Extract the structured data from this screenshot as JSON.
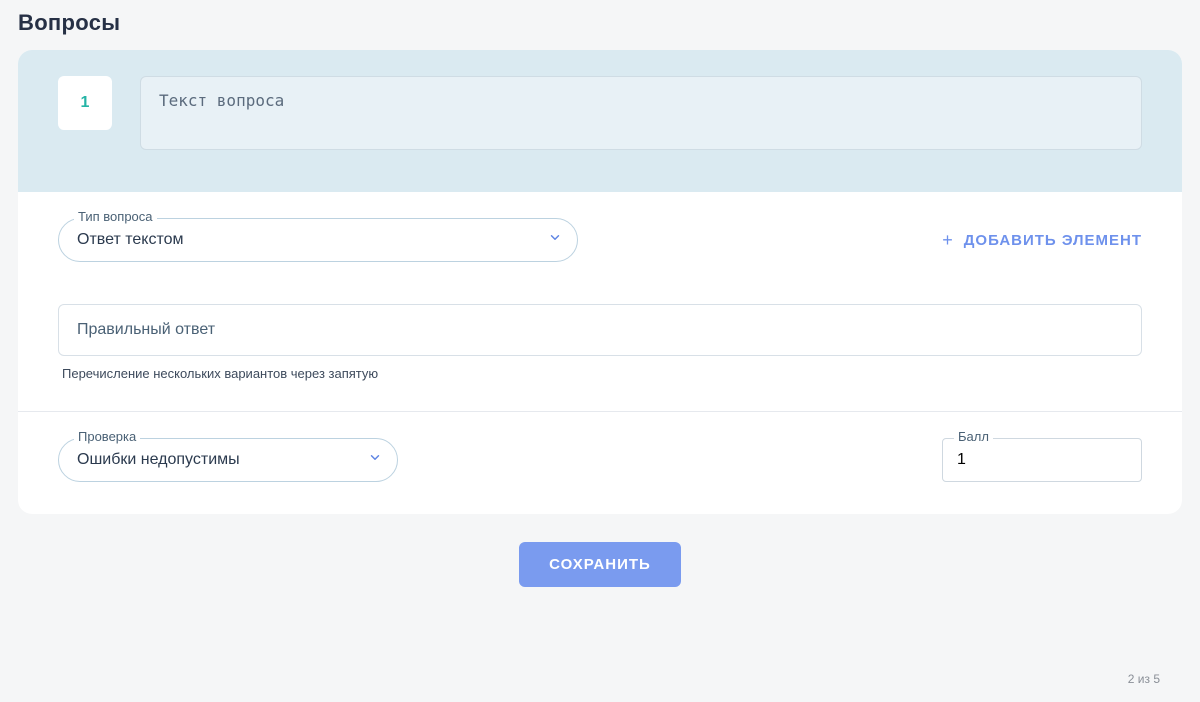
{
  "page": {
    "title": "Вопросы",
    "pager": "2 из 5"
  },
  "question": {
    "number": "1",
    "text_placeholder": "Текст вопроса"
  },
  "type_field": {
    "label": "Тип вопроса",
    "value": "Ответ текстом"
  },
  "add_element": {
    "label": "ДОБАВИТЬ ЭЛЕМЕНТ"
  },
  "answer": {
    "placeholder": "Правильный ответ",
    "helper": "Перечисление нескольких вариантов через запятую"
  },
  "check_field": {
    "label": "Проверка",
    "value": "Ошибки недопустимы"
  },
  "score": {
    "label": "Балл",
    "value": "1"
  },
  "save": {
    "label": "СОХРАНИТЬ"
  }
}
